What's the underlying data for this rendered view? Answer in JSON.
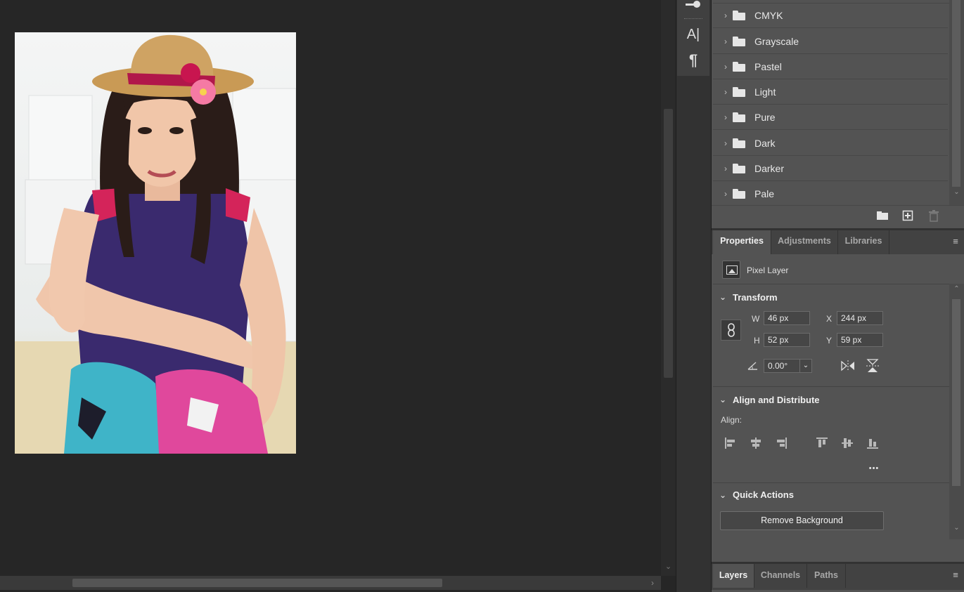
{
  "swatches": {
    "groups": [
      {
        "label": "CMYK"
      },
      {
        "label": "Grayscale"
      },
      {
        "label": "Pastel"
      },
      {
        "label": "Light"
      },
      {
        "label": "Pure"
      },
      {
        "label": "Dark"
      },
      {
        "label": "Darker"
      },
      {
        "label": "Pale"
      }
    ],
    "footer_icons": [
      "folder-icon",
      "new-swatch-icon",
      "trash-icon"
    ]
  },
  "toolstrip": {
    "icons": [
      "slider-icon",
      "character-icon",
      "paragraph-icon"
    ],
    "character_glyph": "A|",
    "paragraph_glyph": "¶"
  },
  "properties_panel": {
    "tabs": [
      "Properties",
      "Adjustments",
      "Libraries"
    ],
    "active_tab": "Properties",
    "layer_type": "Pixel Layer",
    "transform": {
      "title": "Transform",
      "w_label": "W",
      "w_value": "46 px",
      "h_label": "H",
      "h_value": "52 px",
      "x_label": "X",
      "x_value": "244 px",
      "y_label": "Y",
      "y_value": "59 px",
      "angle_value": "0.00°"
    },
    "align": {
      "title": "Align and Distribute",
      "label": "Align:",
      "more": "•••"
    },
    "quick_actions": {
      "title": "Quick Actions",
      "remove_bg_label": "Remove Background"
    }
  },
  "bottom_panel": {
    "tabs": [
      "Layers",
      "Channels",
      "Paths"
    ],
    "active_tab": "Layers"
  },
  "colors": {
    "canvas_bg": "#262626",
    "panel_bg": "#535353",
    "accent_text": "#f0f0f0"
  }
}
